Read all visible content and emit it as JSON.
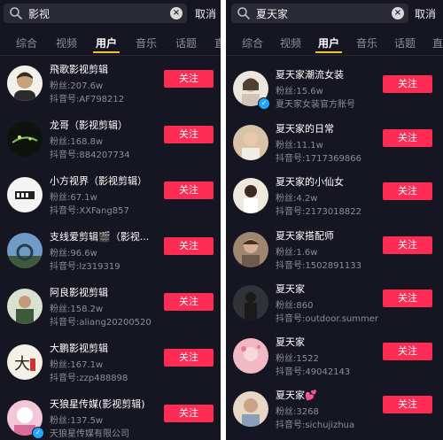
{
  "left": {
    "search_query": "影视",
    "cancel_label": "取消",
    "tabs": [
      {
        "label": "综合"
      },
      {
        "label": "视频"
      },
      {
        "label": "用户"
      },
      {
        "label": "音乐"
      },
      {
        "label": "话题"
      },
      {
        "label": "直"
      }
    ],
    "active_tab": "用户",
    "users": [
      {
        "name": "飛歌影视剪辑",
        "fans": "粉丝:207.6w",
        "dyid": "抖音号:AF798212",
        "follow": "关注",
        "avatar_color": "#c8a27a"
      },
      {
        "name": "龙哥（影视剪辑）",
        "fans": "粉丝:168.8w",
        "dyid": "抖音号:884207734",
        "follow": "关注",
        "avatar_color": "#1e2a1e"
      },
      {
        "name": "小方视界（影视剪辑）",
        "fans": "粉丝:67.1w",
        "dyid": "抖音号:XXFang857",
        "follow": "关注",
        "avatar_color": "#f2f2f2"
      },
      {
        "name": "支线爱剪辑🎬（影视...",
        "fans": "粉丝:96.6w",
        "dyid": "抖音号:lz319319",
        "follow": "关注",
        "avatar_color": "#5a8ab5"
      },
      {
        "name": "阿良影视剪辑",
        "fans": "粉丝:158.2w",
        "dyid": "抖音号:aliang20200520",
        "follow": "关注",
        "avatar_color": "#3e5a3a"
      },
      {
        "name": "大鹏影视剪辑",
        "fans": "粉丝:167.1w",
        "dyid": "抖音号:zzp488898",
        "follow": "关注",
        "avatar_color": "#f3efe6"
      },
      {
        "name": "天狼星传媒(影视剪辑)",
        "fans": "粉丝:137.5w",
        "dyid": "天狼星传媒有限公司",
        "follow": "关注",
        "avatar_color": "#e8a0c0"
      }
    ]
  },
  "right": {
    "search_query": "夏天家",
    "cancel_label": "取消",
    "tabs": [
      {
        "label": "综合"
      },
      {
        "label": "视频"
      },
      {
        "label": "用户"
      },
      {
        "label": "音乐"
      },
      {
        "label": "话题"
      },
      {
        "label": "直"
      }
    ],
    "active_tab": "用户",
    "users": [
      {
        "name": "夏天家潮流女装",
        "fans": "粉丝:15.6w",
        "dyid": "夏天家女装官方账号",
        "follow": "关注",
        "avatar_color": "#d9c9b8"
      },
      {
        "name": "夏天家的日常",
        "fans": "粉丝:11.1w",
        "dyid": "抖音号:1717369866",
        "follow": "关注",
        "avatar_color": "#c9a58a"
      },
      {
        "name": "夏天家的小仙女",
        "fans": "粉丝:4.2w",
        "dyid": "抖音号:2173018822",
        "follow": "关注",
        "avatar_color": "#e6dccd"
      },
      {
        "name": "夏天家搭配师",
        "fans": "粉丝:1.6w",
        "dyid": "抖音号:1502891133",
        "follow": "关注",
        "avatar_color": "#b59a7d"
      },
      {
        "name": "夏天家",
        "fans": "粉丝:860",
        "dyid": "抖音号:outdoor.summer",
        "follow": "关注",
        "avatar_color": "#3a3a3a"
      },
      {
        "name": "夏天家",
        "fans": "粉丝:1522",
        "dyid": "抖音号:49042143",
        "follow": "关注",
        "avatar_color": "#e7a6b3"
      },
      {
        "name": "夏天家💕",
        "fans": "粉丝:3268",
        "dyid": "抖音号:sichujizhua",
        "follow": "关注",
        "avatar_color": "#d7c1a6"
      }
    ]
  },
  "colors": {
    "background": "#161622",
    "follow_button": "#fe2c55",
    "tab_underline": "#f1c232",
    "verified_badge": "#21a5ff"
  }
}
